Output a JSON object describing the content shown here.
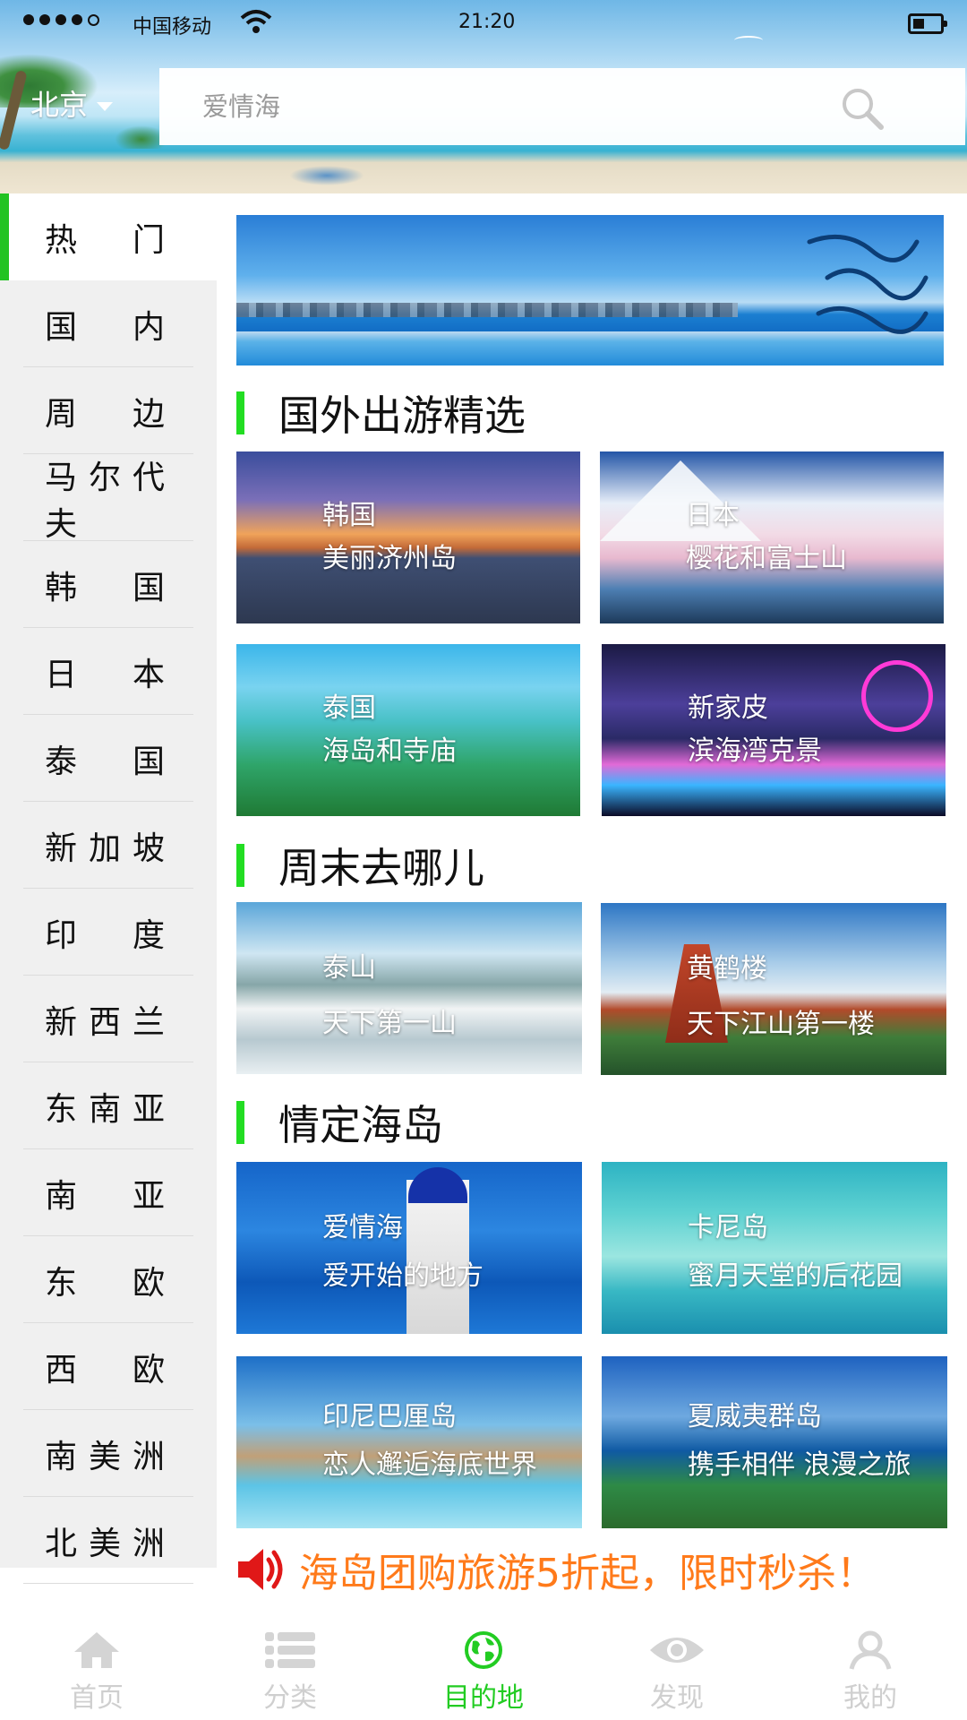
{
  "status_bar": {
    "carrier": "中国移动",
    "time": "21:20"
  },
  "header": {
    "city": "北京",
    "search_placeholder": "爱情海"
  },
  "sidebar": {
    "items": [
      {
        "label": "热门",
        "active": true
      },
      {
        "label": "国内"
      },
      {
        "label": "周边"
      },
      {
        "label": "马尔代夫"
      },
      {
        "label": "韩国"
      },
      {
        "label": "日本"
      },
      {
        "label": "泰国"
      },
      {
        "label": "新加坡"
      },
      {
        "label": "印度"
      },
      {
        "label": "新西兰"
      },
      {
        "label": "东南亚"
      },
      {
        "label": "南亚"
      },
      {
        "label": "东欧"
      },
      {
        "label": "西欧"
      },
      {
        "label": "南美洲"
      },
      {
        "label": "北美洲"
      }
    ]
  },
  "sections": {
    "abroad": {
      "title": "国外出游精选",
      "cards": [
        {
          "title": "韩国",
          "subtitle": "美丽济州岛"
        },
        {
          "title": "日本",
          "subtitle": "樱花和富士山"
        },
        {
          "title": "泰国",
          "subtitle": "海岛和寺庙"
        },
        {
          "title": "新家皮",
          "subtitle": "滨海湾克景"
        }
      ]
    },
    "weekend": {
      "title": "周末去哪儿",
      "cards": [
        {
          "title": "泰山",
          "subtitle": "天下第一山"
        },
        {
          "title": "黄鹤楼",
          "subtitle": "天下江山第一楼"
        }
      ]
    },
    "islands": {
      "title": "情定海岛",
      "cards": [
        {
          "title": "爱情海",
          "subtitle": "爱开始的地方"
        },
        {
          "title": "卡尼岛",
          "subtitle": "蜜月天堂的后花园"
        },
        {
          "title": "印尼巴厘岛",
          "subtitle": "恋人邂逅海底世界"
        },
        {
          "title": "夏威夷群岛",
          "subtitle": "携手相伴 浪漫之旅"
        }
      ]
    }
  },
  "promo": {
    "text": "海岛团购旅游5折起，限时秒杀！"
  },
  "tabbar": {
    "items": [
      {
        "label": "首页",
        "icon": "home-icon"
      },
      {
        "label": "分类",
        "icon": "list-icon"
      },
      {
        "label": "目的地",
        "icon": "globe-icon",
        "active": true
      },
      {
        "label": "发现",
        "icon": "eye-icon"
      },
      {
        "label": "我的",
        "icon": "user-icon"
      }
    ]
  },
  "colors": {
    "accent_green": "#22cc22",
    "promo_orange": "#ff7a1a",
    "sidebar_bg": "#f0f0f0",
    "tab_inactive": "#cfcfcf"
  }
}
